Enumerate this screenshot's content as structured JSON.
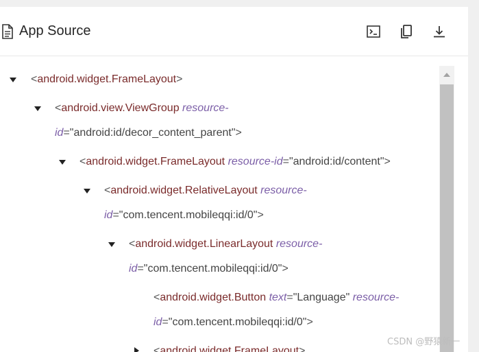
{
  "header": {
    "title": "App Source",
    "tools": [
      {
        "name": "terminal-icon"
      },
      {
        "name": "copy-icon"
      },
      {
        "name": "download-icon"
      }
    ]
  },
  "tree": {
    "nodes": [
      {
        "open": "<",
        "tag": "android.widget.FrameLayout",
        "close": ">"
      },
      {
        "open": "<",
        "tag": "android.view.ViewGroup",
        "attr1": "resource-",
        "attr2": "id",
        "eq": "=",
        "value": "\"android:id/decor_content_parent\"",
        "close": ">"
      },
      {
        "open": "<",
        "tag": "android.widget.FrameLayout",
        "attr": "resource-id",
        "eq": "=",
        "value": "\"android:id/content\"",
        "close": ">"
      },
      {
        "open": "<",
        "tag": "android.widget.RelativeLayout",
        "attr1": "resource-",
        "attr2": "id",
        "eq": "=",
        "value": "\"com.tencent.mobileqqi:id/0\"",
        "close": ">"
      },
      {
        "open": "<",
        "tag": "android.widget.LinearLayout",
        "attr1": "resource-",
        "attr2": "id",
        "eq": "=",
        "value": "\"com.tencent.mobileqqi:id/0\"",
        "close": ">"
      },
      {
        "open": "<",
        "tag": "android.widget.Button",
        "attrA": "text",
        "eqA": "=",
        "valueA": "\"Language\"",
        "attr1": "resource-",
        "attr2": "id",
        "eq": "=",
        "value": "\"com.tencent.mobileqqi:id/0\"",
        "close": ">"
      },
      {
        "open": "<",
        "tag": "android.widget.FrameLayout",
        "close": ">"
      }
    ]
  },
  "watermark": "CSDN @野猿新一"
}
